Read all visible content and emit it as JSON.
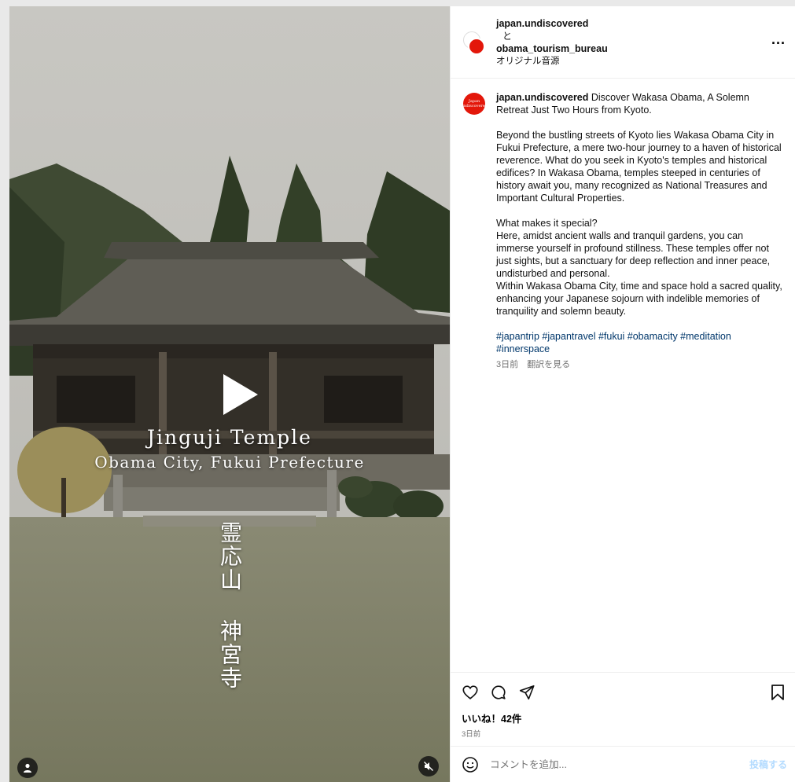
{
  "media": {
    "title_line1": "Jinguji Temple",
    "title_line2": "Obama City, Fukui Prefecture",
    "vertical_text": "霊応山 神宮寺",
    "icons": {
      "play": "play-icon",
      "user": "user-tag-icon",
      "mute": "muted-speaker-icon"
    }
  },
  "header": {
    "user1": "japan.undiscovered",
    "conjunction": "と",
    "user2": "obama_tourism_bureau",
    "audio": "オリジナル音源",
    "more": "..."
  },
  "caption": {
    "username": "japan.undiscovered",
    "headline": " Discover Wakasa Obama, A Solemn Retreat Just Two Hours from Kyoto.",
    "para1": "Beyond the bustling streets of Kyoto lies Wakasa Obama City in Fukui Prefecture, a mere two-hour journey to a haven of historical reverence. What do you seek in Kyoto's temples and historical edifices? In Wakasa Obama, temples steeped in centuries of history await you, many recognized as National Treasures and Important Cultural Properties.",
    "q": "What makes it special?",
    "para2a": "Here, amidst ancient walls and tranquil gardens, you can immerse yourself in profound stillness. These temples offer not just sights, but a sanctuary for deep reflection and inner peace, undisturbed and personal.",
    "para2b": "Within Wakasa Obama City, time and space hold a sacred quality, enhancing your Japanese sojourn with indelible memories of tranquility and solemn beauty.",
    "hashtags": "#japantrip #japantravel #fukui #obamacity #meditation #innerspace",
    "time": "3日前",
    "translate": "翻訳を見る",
    "avatar_text": "Japan undiscovered"
  },
  "actions": {
    "likes": "いいね！42件",
    "date": "3日前",
    "icons": [
      "heart-icon",
      "comment-icon",
      "share-icon",
      "bookmark-icon"
    ]
  },
  "comment": {
    "placeholder": "コメントを追加...",
    "post": "投稿する",
    "emoji_icon": "emoji-icon"
  },
  "colors": {
    "link": "#00376b",
    "brand_red": "#e3170a",
    "post_disabled": "#b3dbff",
    "muted": "#737373"
  }
}
